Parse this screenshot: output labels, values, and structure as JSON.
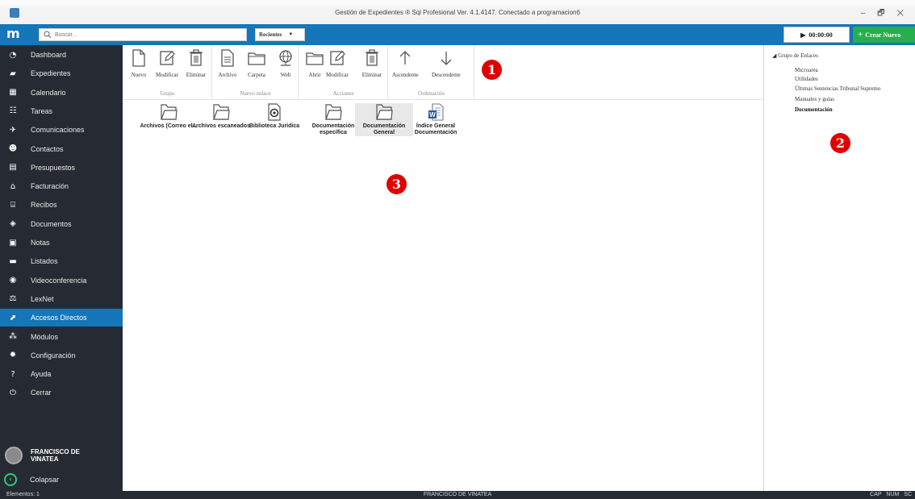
{
  "window": {
    "title": "Gestión de Expedientes ® Sql Profesional Ver. 4.1.4147. Conectado a programacion6",
    "controls": "– 🗗 ✕"
  },
  "topbar": {
    "brand": "m",
    "search_placeholder": "Buscar...",
    "recent_label": "Recientes",
    "timer": "00:00:00",
    "create_label": "Crear Nuevo"
  },
  "sidebar": {
    "items": [
      {
        "label": "Dashboard",
        "icon": "dashboard-icon",
        "glyph": "◔"
      },
      {
        "label": "Expedientes",
        "icon": "briefcase-icon",
        "glyph": "▰"
      },
      {
        "label": "Calendario",
        "icon": "calendar-icon",
        "glyph": "▦"
      },
      {
        "label": "Tareas",
        "icon": "tasks-icon",
        "glyph": "☷"
      },
      {
        "label": "Comunicaciones",
        "icon": "communications-icon",
        "glyph": "✈"
      },
      {
        "label": "Contactos",
        "icon": "contacts-icon",
        "glyph": "☻"
      },
      {
        "label": "Presupuestos",
        "icon": "budget-icon",
        "glyph": "▤"
      },
      {
        "label": "Facturación",
        "icon": "billing-icon",
        "glyph": "⌂"
      },
      {
        "label": "Recibos",
        "icon": "receipts-icon",
        "glyph": "⌸"
      },
      {
        "label": "Documentos",
        "icon": "documents-icon",
        "glyph": "◈"
      },
      {
        "label": "Notas",
        "icon": "notes-icon",
        "glyph": "▣"
      },
      {
        "label": "Listados",
        "icon": "listings-icon",
        "glyph": "▬"
      },
      {
        "label": "Videoconferencia",
        "icon": "videoconference-icon",
        "glyph": "◉"
      },
      {
        "label": "LexNet",
        "icon": "lexnet-icon",
        "glyph": "⚖"
      },
      {
        "label": "Accesos Directos",
        "icon": "shortcuts-icon",
        "glyph": "⬈",
        "active": true
      },
      {
        "label": "Módulos",
        "icon": "modules-icon",
        "glyph": "⁂"
      },
      {
        "label": "Configuración",
        "icon": "settings-icon",
        "glyph": "✹"
      },
      {
        "label": "Ayuda",
        "icon": "help-icon",
        "glyph": "?"
      },
      {
        "label": "Cerrar",
        "icon": "power-icon",
        "glyph": "⏻"
      }
    ],
    "user_name": "FRANCISCO DE VINATEA",
    "collapse_label": "Colapsar"
  },
  "ribbon": {
    "groups": [
      {
        "title": "Grupo",
        "buttons": [
          "Nuevo",
          "Modificar",
          "Eliminar"
        ]
      },
      {
        "title": "Nuevo enlace",
        "buttons": [
          "Archivo",
          "Carpeta",
          "Web"
        ]
      },
      {
        "title": "Acciones",
        "buttons": [
          "Abrir",
          "Modificar",
          "Eliminar"
        ]
      },
      {
        "title": "Ordenación",
        "buttons": [
          "Ascendente",
          "Descendente"
        ]
      }
    ]
  },
  "markers": [
    "1",
    "2",
    "3"
  ],
  "shortcuts": [
    {
      "label": "Archivos (Correo el...",
      "icon": "folder-icon"
    },
    {
      "label": "Archivos escaneados",
      "icon": "folder-icon"
    },
    {
      "label": "Biblioteca Jurídica",
      "icon": "web-link-icon"
    },
    {
      "label": "Documentación específica",
      "icon": "folder-icon"
    },
    {
      "label": "Documentación General",
      "icon": "folder-icon",
      "selected": true
    },
    {
      "label": "Índice General Documentación",
      "icon": "word-document-icon"
    }
  ],
  "link_tree": {
    "root": "Grupo de Enlaces",
    "items": [
      {
        "label": "Microarea",
        "bold": false
      },
      {
        "label": "Utilidades",
        "bold": false
      },
      {
        "label": "Últimas Sentencias Tribunal Supremo",
        "bold": false
      },
      {
        "label": "Manuales y guías",
        "bold": false
      },
      {
        "label": "Documentación",
        "bold": true
      }
    ]
  },
  "statusbar": {
    "left": "Elementos: 1",
    "center": "FRANCISCO DE VINATEA",
    "right": "CAP NUM SC"
  },
  "colors": {
    "accent": "#1576b9",
    "sidebar_bg": "#262b33",
    "create_btn": "#27ae4e",
    "marker": "#e00000"
  }
}
